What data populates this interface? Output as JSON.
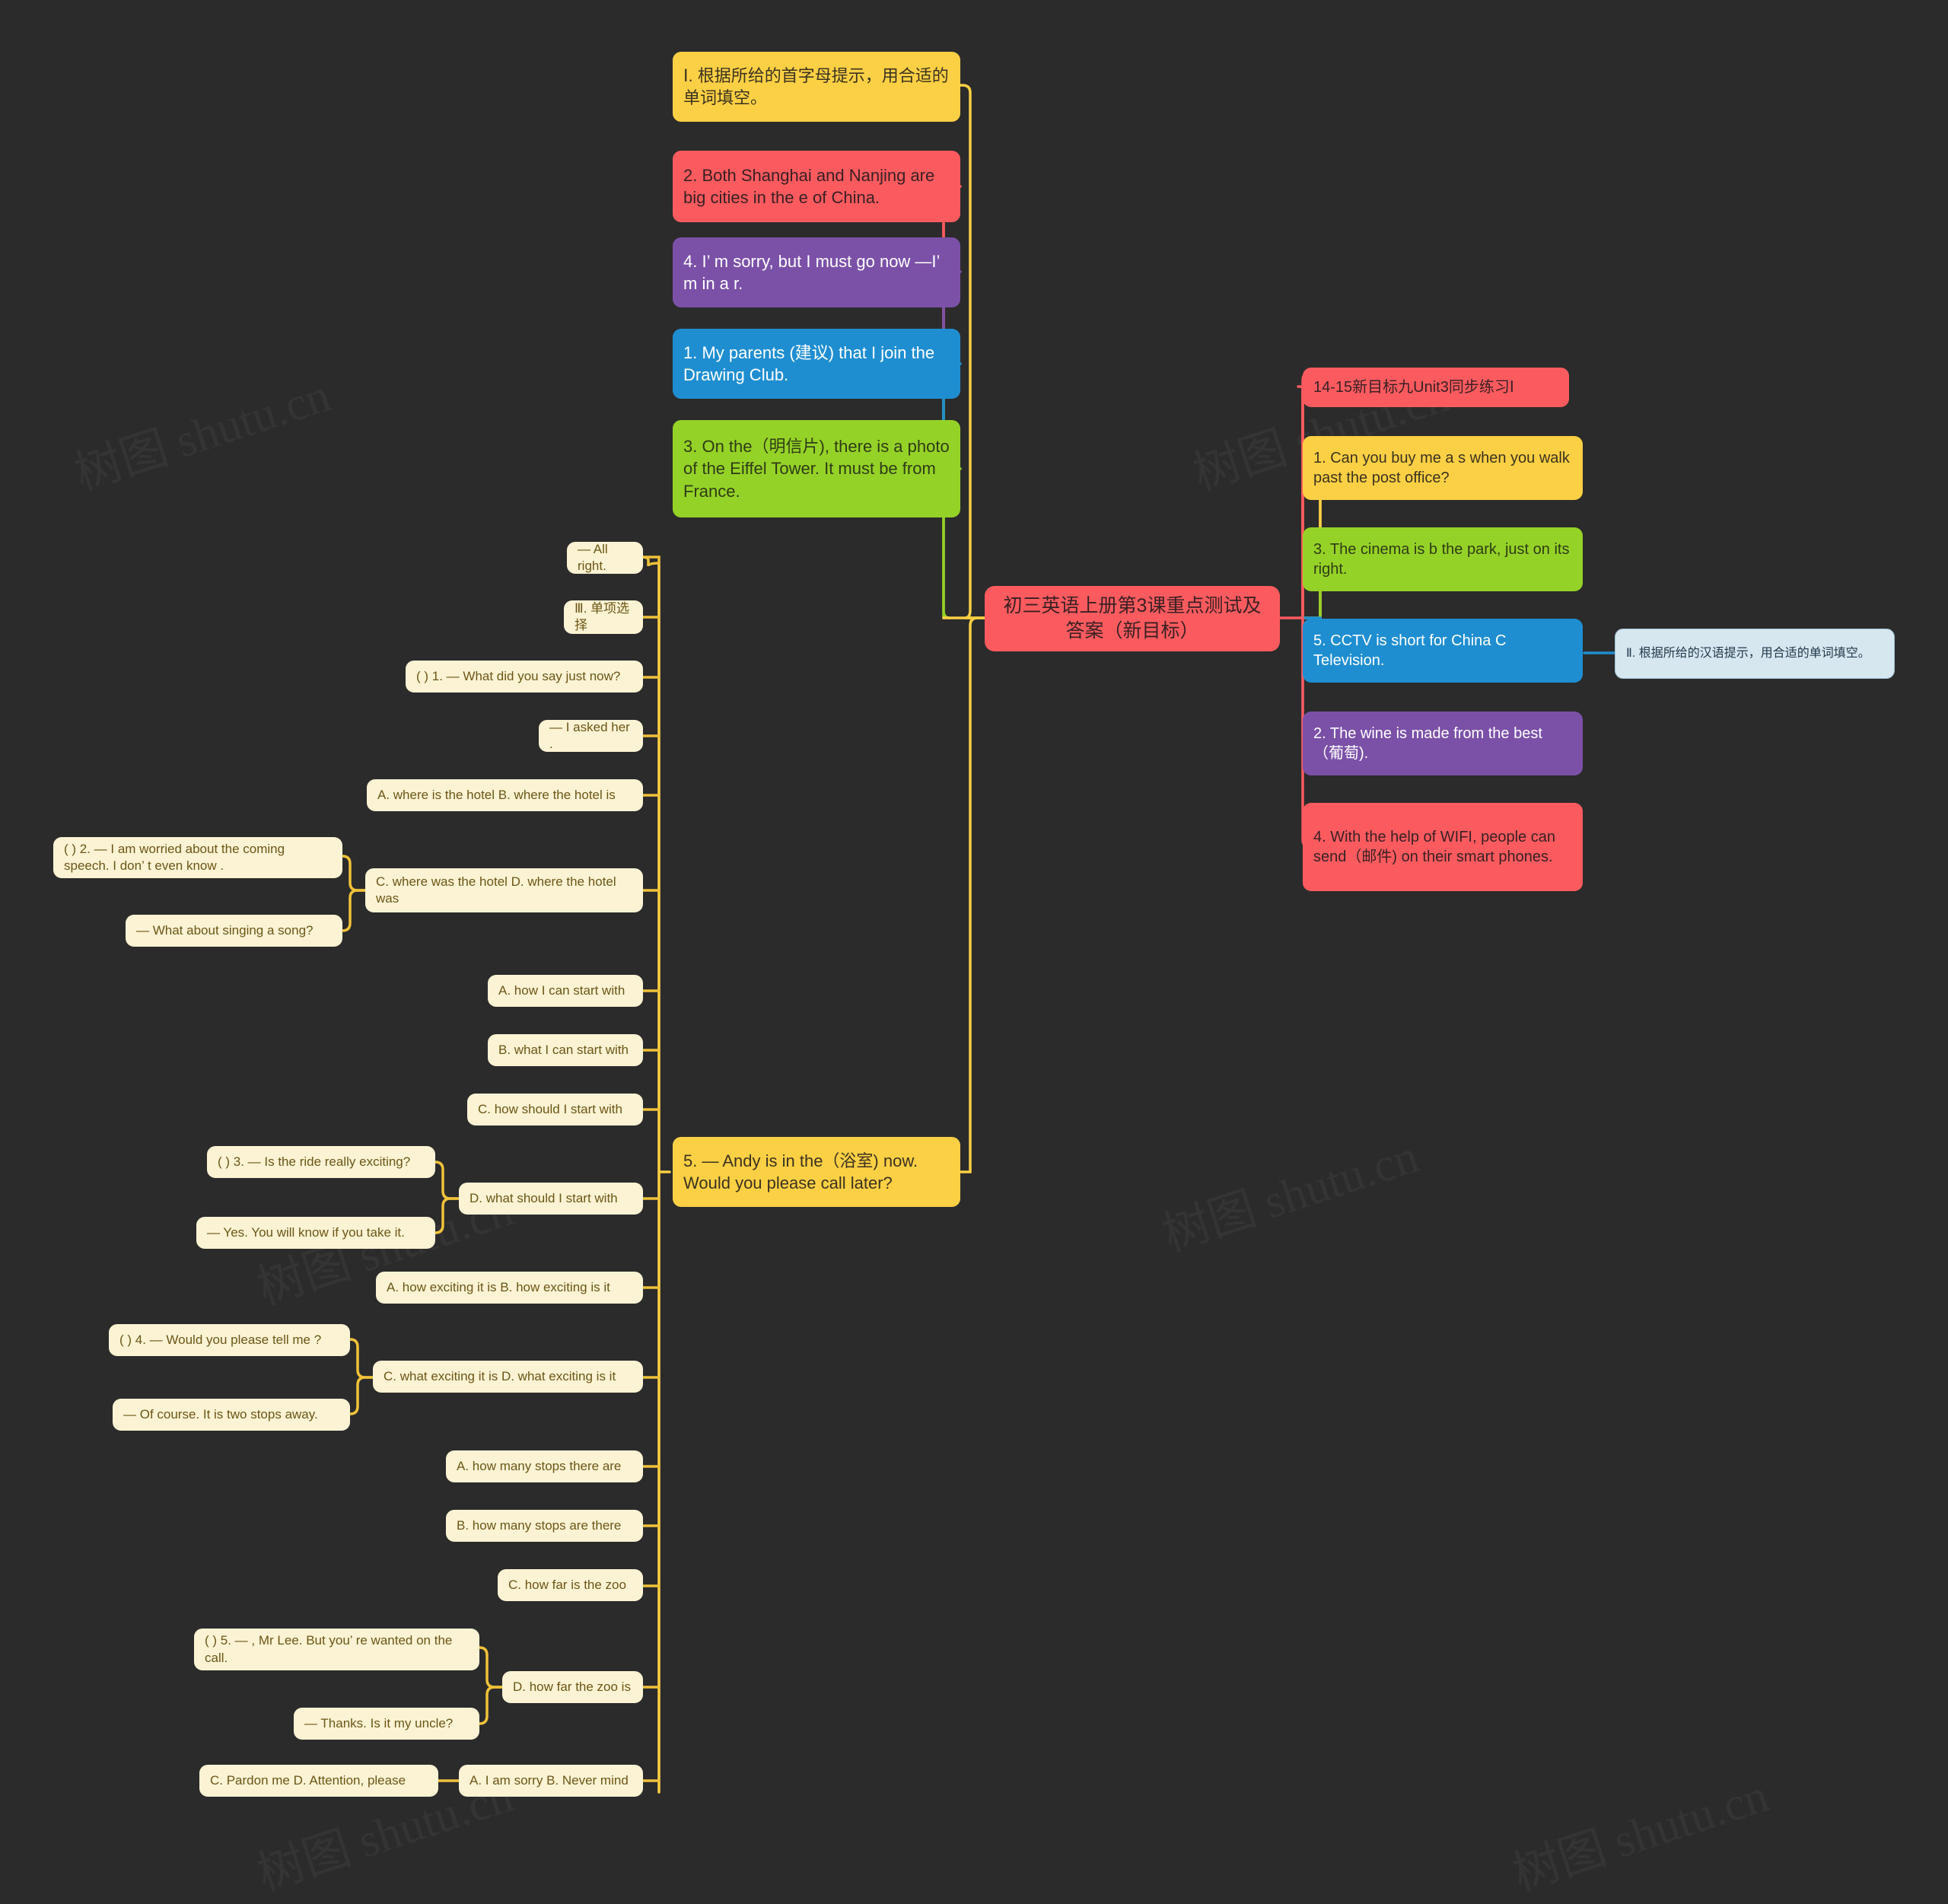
{
  "document": {
    "type": "mindmap",
    "background_color": "#2b2b2b",
    "watermark_text": "树图 shutu.cn"
  },
  "center": {
    "title": "初三英语上册第3课重点测试及答案（新目标）",
    "color": "#fb5b5f"
  },
  "left_branch": {
    "topic_nodes": [
      {
        "label": "Ⅰ. 根据所给的首字母提示，用合适的单词填空。",
        "color": "#fcd044"
      },
      {
        "label": "2. Both Shanghai and Nanjing are big cities in the e of China.",
        "color": "#fb5b5f"
      },
      {
        "label": "4. I’ m sorry, but I must go now —I’ m in a r.",
        "color": "#7b51a8"
      },
      {
        "label": "1. My parents (建议) that I join the Drawing Club.",
        "color": "#1f8ed1"
      },
      {
        "label": "3. On the（明信片), there is a photo of the Eiffel Tower. It must be from France.",
        "color": "#95d227"
      },
      {
        "label": "5. — Andy is in the（浴室) now. Would you please call later?",
        "color": "#fcd044"
      }
    ],
    "choice_nodes": [
      {
        "label": "— All right."
      },
      {
        "label": "Ⅲ. 单项选择"
      },
      {
        "label": "( ) 1. — What did you say just now?"
      },
      {
        "label": "— I asked her ."
      },
      {
        "label": "A. where is the hotel B. where the hotel is"
      },
      {
        "label": "( ) 2. — I am worried about the coming speech. I don’ t even know ."
      },
      {
        "label": "C. where was the hotel D. where the hotel was"
      },
      {
        "label": "— What about singing a song?"
      },
      {
        "label": "A. how I can start with"
      },
      {
        "label": "B. what I can start with"
      },
      {
        "label": "C. how should I start with"
      },
      {
        "label": "( ) 3. — Is the ride really exciting?"
      },
      {
        "label": "D. what should I start with"
      },
      {
        "label": "— Yes. You will know  if you take it."
      },
      {
        "label": "A. how exciting it is B. how exciting is it"
      },
      {
        "label": "( ) 4. — Would you please tell me ?"
      },
      {
        "label": "C. what exciting it is D. what exciting is it"
      },
      {
        "label": "— Of course. It is two stops away."
      },
      {
        "label": "A. how many stops there are"
      },
      {
        "label": "B. how many stops are there"
      },
      {
        "label": "C. how far is the zoo"
      },
      {
        "label": "( ) 5. — , Mr Lee. But you’ re wanted on the call."
      },
      {
        "label": "D. how far the zoo is"
      },
      {
        "label": "— Thanks. Is it my uncle?"
      },
      {
        "label": "C. Pardon me D. Attention, please"
      },
      {
        "label": "A. I am sorry B. Never mind"
      }
    ]
  },
  "right_branch": {
    "nodes": [
      {
        "label": "14-15新目标九Unit3同步练习Ⅰ",
        "color": "#fb5b5f"
      },
      {
        "label": "1. Can you buy me a s when you walk past the post office?",
        "color": "#fcd044"
      },
      {
        "label": "3. The cinema is b the park, just on its right.",
        "color": "#95d227"
      },
      {
        "label": "5. CCTV is short for China C Television.",
        "color": "#1f8ed1"
      },
      {
        "label": "2. The wine is made from the best（葡萄).",
        "color": "#7b51a8"
      },
      {
        "label": "4. With the help of WIFI, people can send（邮件) on their smart phones.",
        "color": "#fb5b5f"
      }
    ],
    "sub_node": {
      "label": "Ⅱ. 根据所给的汉语提示，用合适的单词填空。",
      "color": "#d6e7f0"
    }
  }
}
